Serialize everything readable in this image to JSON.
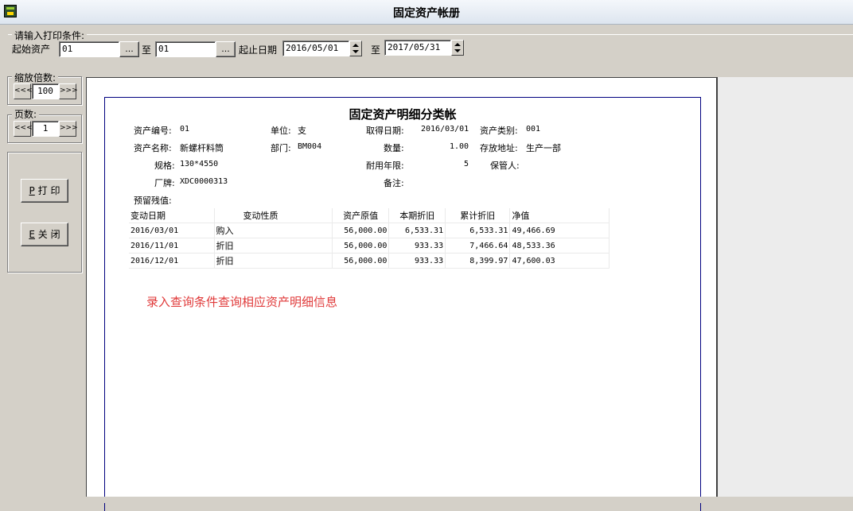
{
  "window": {
    "title": "固定资产帐册"
  },
  "conditions": {
    "legend": "请输入打印条件:",
    "asset_start_label": "起始资产",
    "asset_start_value": "01",
    "browse_label": "...",
    "to_label": "至",
    "asset_end_value": "01",
    "date_label": "起止日期",
    "date_start": "2016/05/01",
    "date_to_label": "至",
    "date_end": "2017/05/31"
  },
  "zoom": {
    "label": "缩放倍数:",
    "prev": "<<<",
    "value": "100",
    "next": ">>>"
  },
  "pages": {
    "label": "页数:",
    "prev": "<<<",
    "value": "1",
    "next": ">>>"
  },
  "actions": {
    "print_key": "P",
    "print_label": "打 印",
    "close_key": "E",
    "close_label": "关 闭"
  },
  "report": {
    "title": "固定资产明细分类帐",
    "fields": {
      "asset_no_label": "资产编号:",
      "asset_no": "01",
      "unit_label": "单位:",
      "unit": "支",
      "acq_date_label": "取得日期:",
      "acq_date": "2016/03/01",
      "category_label": "资产类别:",
      "category": "001",
      "name_label": "资产名称:",
      "name": "新螺杆料筒",
      "dept_label": "部门:",
      "dept": "BM004",
      "qty_label": "数量:",
      "qty": "1.00",
      "location_label": "存放地址:",
      "location": "生产一部",
      "spec_label": "规格:",
      "spec": "130*4550",
      "life_label": "耐用年限:",
      "life": "5",
      "keeper_label": "保管人:",
      "brand_label": "厂牌:",
      "brand": "XDC0000313",
      "remark_label": "备注:",
      "residual_label": "预留残值:"
    },
    "columns": [
      "变动日期",
      "变动性质",
      "资产原值",
      "本期折旧",
      "累计折旧",
      "净值"
    ],
    "rows": [
      [
        "2016/03/01",
        "购入",
        "56,000.00",
        "6,533.31",
        "6,533.31",
        "49,466.69"
      ],
      [
        "2016/11/01",
        "折旧",
        "56,000.00",
        "933.33",
        "7,466.64",
        "48,533.36"
      ],
      [
        "2016/12/01",
        "折旧",
        "56,000.00",
        "933.33",
        "8,399.97",
        "47,600.03"
      ]
    ],
    "hint": "录入查询条件查询相应资产明细信息"
  }
}
